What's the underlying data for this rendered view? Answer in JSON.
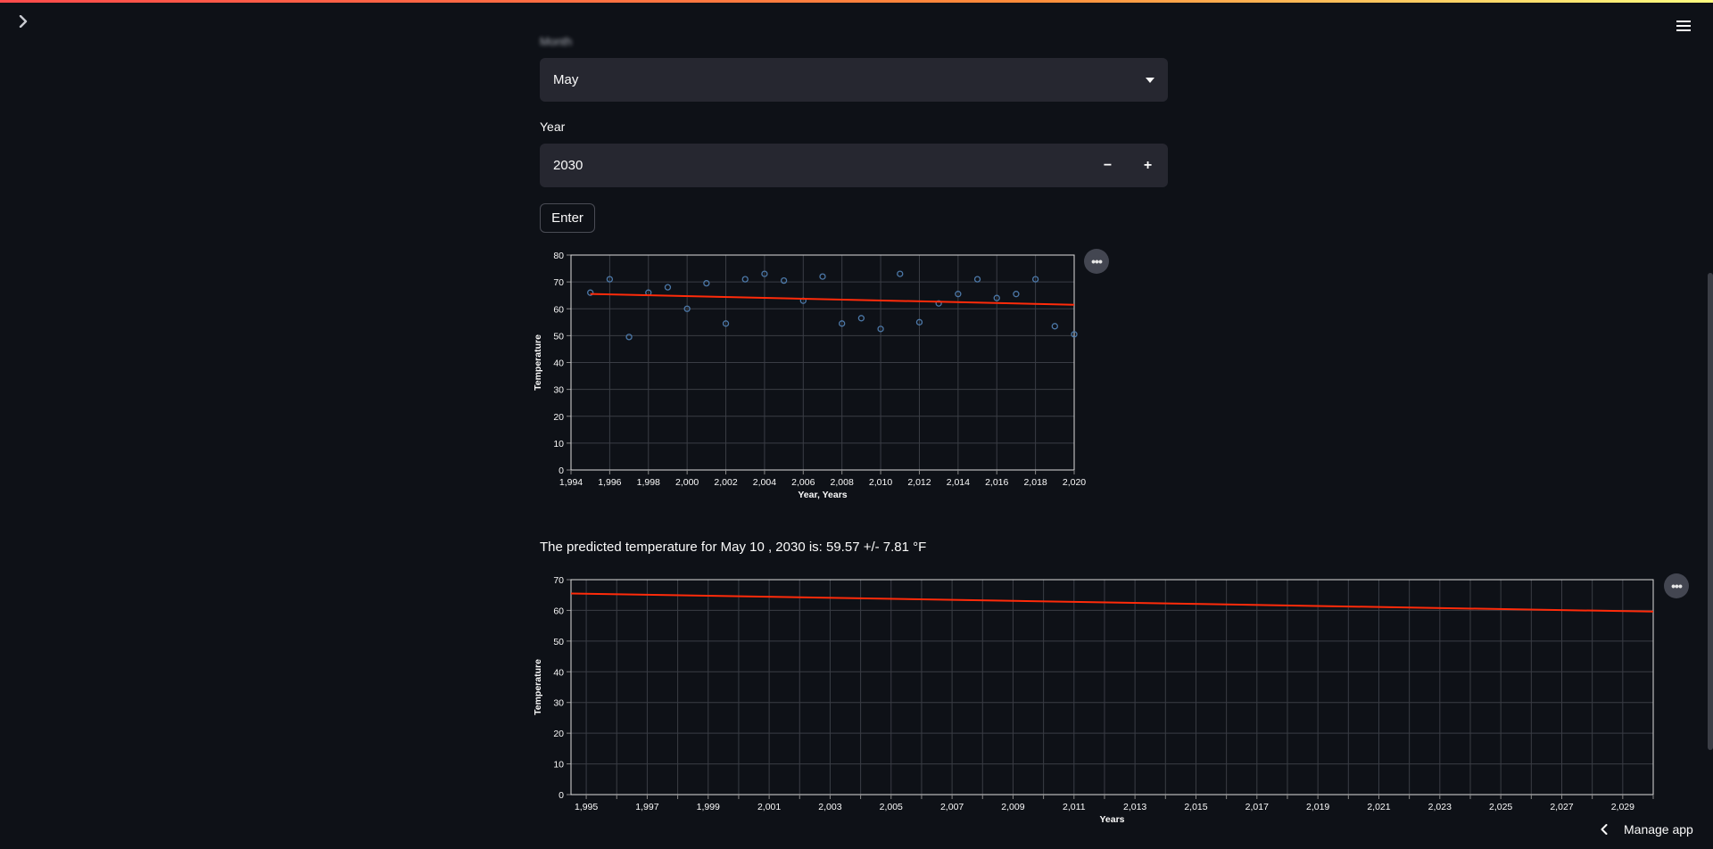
{
  "app": {
    "blurred_label": "Month",
    "month_label": "",
    "month_value": "May",
    "year_label": "Year",
    "year_value": "2030",
    "decrement_symbol": "−",
    "increment_symbol": "+",
    "enter_label": "Enter",
    "prediction_text": "The predicted temperature for May 10 , 2030 is: 59.57 +/- 7.81 °F",
    "manage_app_label": "Manage app",
    "chart_menu_symbol": "•••"
  },
  "colors": {
    "background": "#0e1117",
    "input_bg": "#262730",
    "grid": "#3a3d45",
    "regression_line": "#ff2b0a",
    "scatter_points": "#4c78a8",
    "text": "#fafafa"
  },
  "chart_data": [
    {
      "type": "scatter",
      "xlabel": "Year, Years",
      "ylabel": "Temperature",
      "xlim": [
        1994,
        2020
      ],
      "ylim": [
        0,
        80
      ],
      "xticks": [
        1994,
        1996,
        1998,
        2000,
        2002,
        2004,
        2006,
        2008,
        2010,
        2012,
        2014,
        2016,
        2018,
        2020
      ],
      "xtick_labels": [
        "1,994",
        "1,996",
        "1,998",
        "2,000",
        "2,002",
        "2,004",
        "2,006",
        "2,008",
        "2,010",
        "2,012",
        "2,014",
        "2,016",
        "2,018",
        "2,020"
      ],
      "yticks": [
        0,
        10,
        20,
        30,
        40,
        50,
        60,
        70,
        80
      ],
      "ytick_labels": [
        "0",
        "10",
        "20",
        "30",
        "40",
        "50",
        "60",
        "70",
        "80"
      ],
      "grid": true,
      "points": {
        "x": [
          1995,
          1996,
          1997,
          1998,
          1999,
          2000,
          2001,
          2002,
          2003,
          2004,
          2005,
          2006,
          2007,
          2008,
          2009,
          2010,
          2011,
          2012,
          2013,
          2014,
          2015,
          2016,
          2017,
          2018,
          2019,
          2020
        ],
        "y": [
          66,
          71,
          49.5,
          66,
          68,
          60,
          69.5,
          54.5,
          71,
          73,
          70.5,
          63,
          72,
          54.5,
          56.5,
          52.5,
          73,
          55,
          62,
          65.5,
          71,
          64,
          65.5,
          71,
          53.5,
          50.5
        ]
      },
      "trend_line": {
        "x": [
          1995,
          2020
        ],
        "y": [
          65.5,
          61.5
        ]
      }
    },
    {
      "type": "line",
      "xlabel": "Years",
      "ylabel": "Temperature",
      "xlim": [
        1994.5,
        2030
      ],
      "ylim": [
        0,
        70
      ],
      "xticks": [
        1995,
        1996,
        1997,
        1998,
        1999,
        2000,
        2001,
        2002,
        2003,
        2004,
        2005,
        2006,
        2007,
        2008,
        2009,
        2010,
        2011,
        2012,
        2013,
        2014,
        2015,
        2016,
        2017,
        2018,
        2019,
        2020,
        2021,
        2022,
        2023,
        2024,
        2025,
        2026,
        2027,
        2028,
        2029,
        2030
      ],
      "xtick_labels": [
        "1,995",
        "1,997",
        "1,999",
        "2,001",
        "2,003",
        "2,005",
        "2,007",
        "2,009",
        "2,011",
        "2,013",
        "2,015",
        "2,017",
        "2,019",
        "2,021",
        "2,023",
        "2,025",
        "2,027",
        "2,029"
      ],
      "xtick_label_values": [
        1995,
        1997,
        1999,
        2001,
        2003,
        2005,
        2007,
        2009,
        2011,
        2013,
        2015,
        2017,
        2019,
        2021,
        2023,
        2025,
        2027,
        2029
      ],
      "yticks": [
        0,
        10,
        20,
        30,
        40,
        50,
        60,
        70
      ],
      "ytick_labels": [
        "0",
        "10",
        "20",
        "30",
        "40",
        "50",
        "60",
        "70"
      ],
      "grid": true,
      "trend_line": {
        "x": [
          1994.5,
          2030
        ],
        "y": [
          65.5,
          59.6
        ]
      }
    }
  ]
}
